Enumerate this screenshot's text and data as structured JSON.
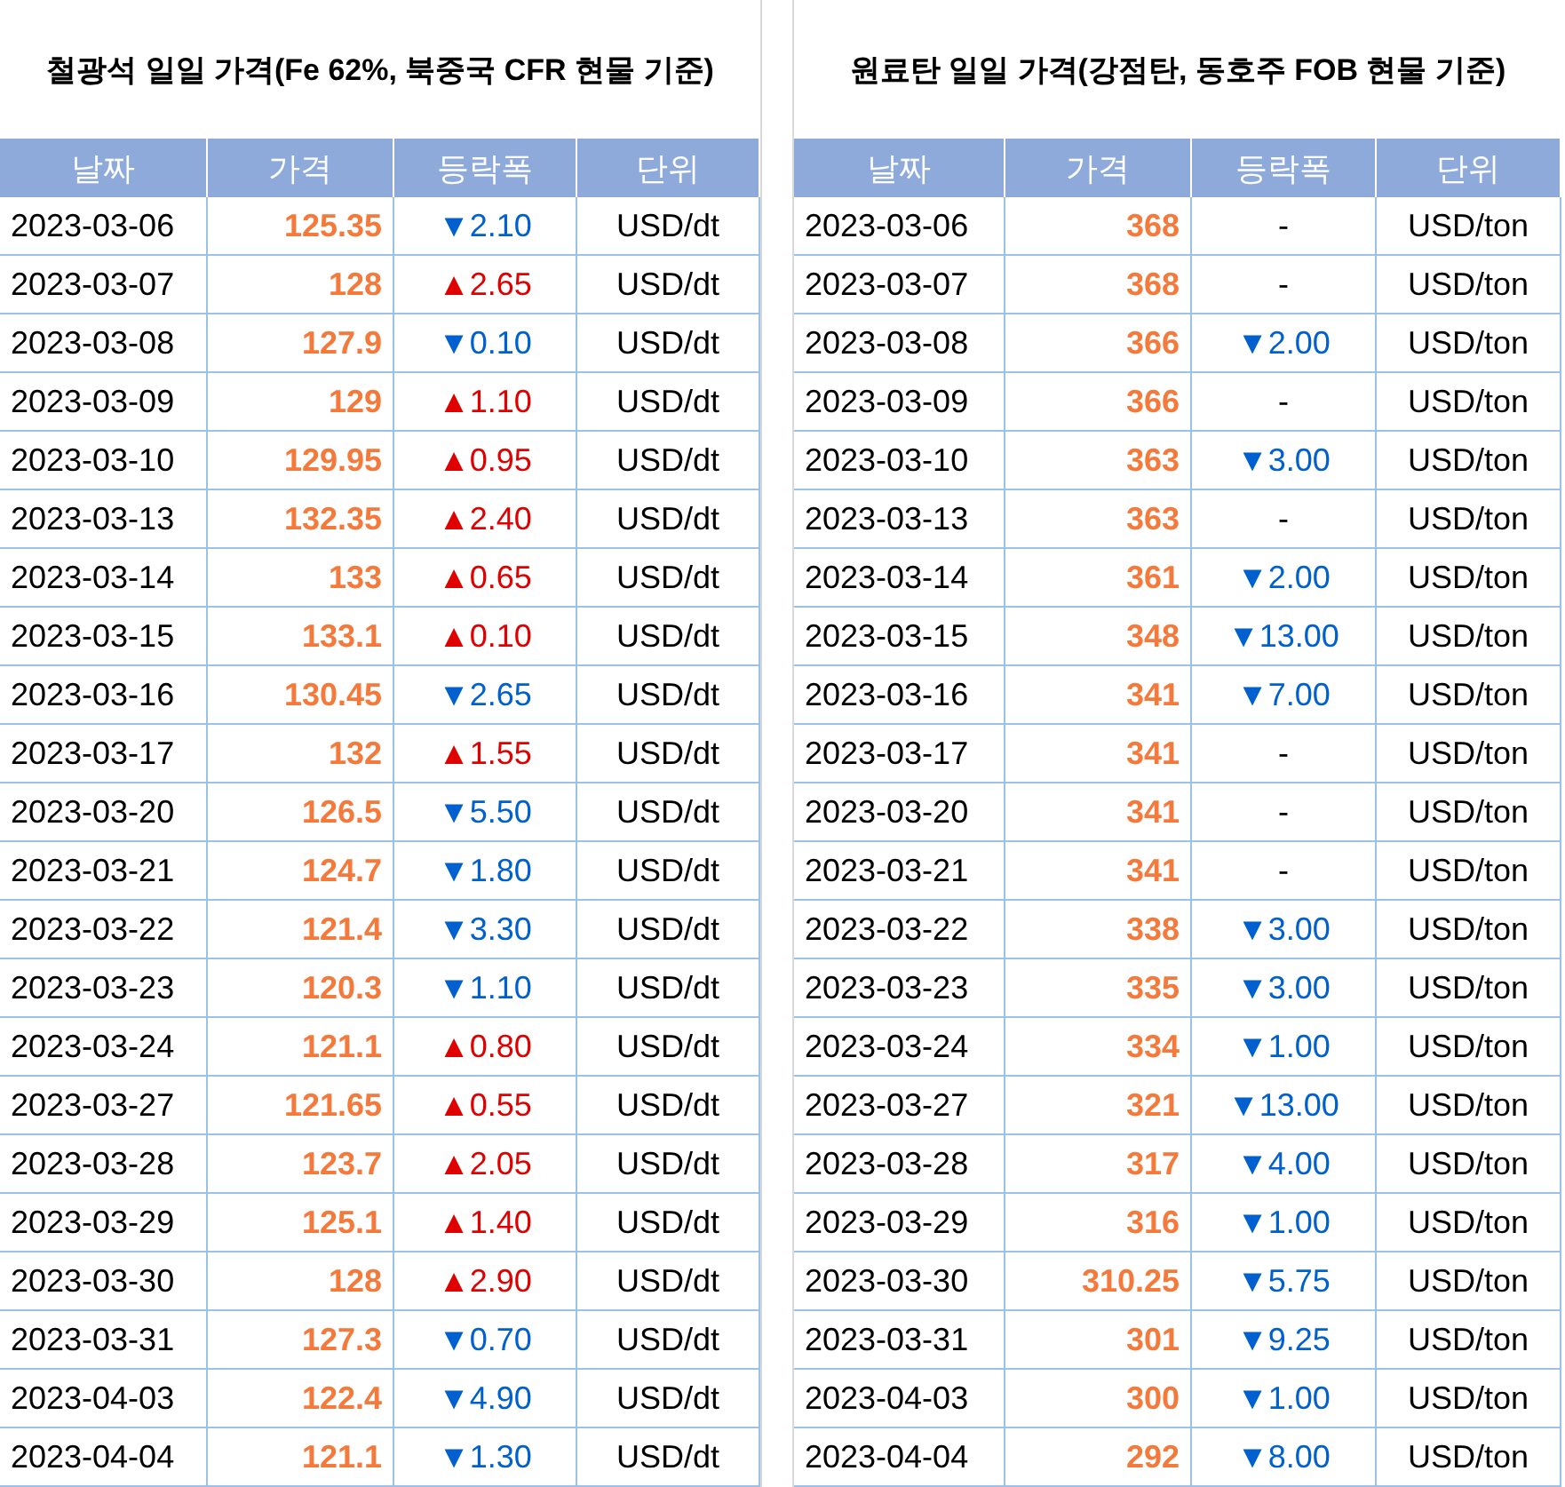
{
  "tables": [
    {
      "title": "철광석 일일 가격(Fe 62%, 북중국 CFR 현물 기준)",
      "columns": [
        "날짜",
        "가격",
        "등락폭",
        "단위"
      ],
      "rows": [
        {
          "date": "2023-03-06",
          "price": "125.35",
          "color": "#0060d0",
          "change": "▼2.10",
          "unit": "USD/dt"
        },
        {
          "date": "2023-03-07",
          "price": "128",
          "color": "#e00000",
          "change": "▲2.65",
          "unit": "USD/dt"
        },
        {
          "date": "2023-03-08",
          "price": "127.9",
          "color": "#0060d0",
          "change": "▼0.10",
          "unit": "USD/dt"
        },
        {
          "date": "2023-03-09",
          "price": "129",
          "color": "#e00000",
          "change": "▲1.10",
          "unit": "USD/dt"
        },
        {
          "date": "2023-03-10",
          "price": "129.95",
          "color": "#e00000",
          "change": "▲0.95",
          "unit": "USD/dt"
        },
        {
          "date": "2023-03-13",
          "price": "132.35",
          "color": "#e00000",
          "change": "▲2.40",
          "unit": "USD/dt"
        },
        {
          "date": "2023-03-14",
          "price": "133",
          "color": "#e00000",
          "change": "▲0.65",
          "unit": "USD/dt"
        },
        {
          "date": "2023-03-15",
          "price": "133.1",
          "color": "#e00000",
          "change": "▲0.10",
          "unit": "USD/dt"
        },
        {
          "date": "2023-03-16",
          "price": "130.45",
          "color": "#0060d0",
          "change": "▼2.65",
          "unit": "USD/dt"
        },
        {
          "date": "2023-03-17",
          "price": "132",
          "color": "#e00000",
          "change": "▲1.55",
          "unit": "USD/dt"
        },
        {
          "date": "2023-03-20",
          "price": "126.5",
          "color": "#0060d0",
          "change": "▼5.50",
          "unit": "USD/dt"
        },
        {
          "date": "2023-03-21",
          "price": "124.7",
          "color": "#0060d0",
          "change": "▼1.80",
          "unit": "USD/dt"
        },
        {
          "date": "2023-03-22",
          "price": "121.4",
          "color": "#0060d0",
          "change": "▼3.30",
          "unit": "USD/dt"
        },
        {
          "date": "2023-03-23",
          "price": "120.3",
          "color": "#0060d0",
          "change": "▼1.10",
          "unit": "USD/dt"
        },
        {
          "date": "2023-03-24",
          "price": "121.1",
          "color": "#e00000",
          "change": "▲0.80",
          "unit": "USD/dt"
        },
        {
          "date": "2023-03-27",
          "price": "121.65",
          "color": "#e00000",
          "change": "▲0.55",
          "unit": "USD/dt"
        },
        {
          "date": "2023-03-28",
          "price": "123.7",
          "color": "#e00000",
          "change": "▲2.05",
          "unit": "USD/dt"
        },
        {
          "date": "2023-03-29",
          "price": "125.1",
          "color": "#e00000",
          "change": "▲1.40",
          "unit": "USD/dt"
        },
        {
          "date": "2023-03-30",
          "price": "128",
          "color": "#e00000",
          "change": "▲2.90",
          "unit": "USD/dt"
        },
        {
          "date": "2023-03-31",
          "price": "127.3",
          "color": "#0060d0",
          "change": "▼0.70",
          "unit": "USD/dt"
        },
        {
          "date": "2023-04-03",
          "price": "122.4",
          "color": "#0060d0",
          "change": "▼4.90",
          "unit": "USD/dt"
        },
        {
          "date": "2023-04-04",
          "price": "121.1",
          "color": "#0060d0",
          "change": "▼1.30",
          "unit": "USD/dt"
        }
      ]
    },
    {
      "title": "원료탄 일일 가격(강점탄, 동호주 FOB 현물 기준)",
      "columns": [
        "날짜",
        "가격",
        "등락폭",
        "단위"
      ],
      "rows": [
        {
          "date": "2023-03-06",
          "price": "368",
          "color": "#000000",
          "change": "-",
          "unit": "USD/ton"
        },
        {
          "date": "2023-03-07",
          "price": "368",
          "color": "#000000",
          "change": "-",
          "unit": "USD/ton"
        },
        {
          "date": "2023-03-08",
          "price": "366",
          "color": "#0060d0",
          "change": "▼2.00",
          "unit": "USD/ton"
        },
        {
          "date": "2023-03-09",
          "price": "366",
          "color": "#000000",
          "change": "-",
          "unit": "USD/ton"
        },
        {
          "date": "2023-03-10",
          "price": "363",
          "color": "#0060d0",
          "change": "▼3.00",
          "unit": "USD/ton"
        },
        {
          "date": "2023-03-13",
          "price": "363",
          "color": "#000000",
          "change": "-",
          "unit": "USD/ton"
        },
        {
          "date": "2023-03-14",
          "price": "361",
          "color": "#0060d0",
          "change": "▼2.00",
          "unit": "USD/ton"
        },
        {
          "date": "2023-03-15",
          "price": "348",
          "color": "#0060d0",
          "change": "▼13.00",
          "unit": "USD/ton"
        },
        {
          "date": "2023-03-16",
          "price": "341",
          "color": "#0060d0",
          "change": "▼7.00",
          "unit": "USD/ton"
        },
        {
          "date": "2023-03-17",
          "price": "341",
          "color": "#000000",
          "change": "-",
          "unit": "USD/ton"
        },
        {
          "date": "2023-03-20",
          "price": "341",
          "color": "#000000",
          "change": "-",
          "unit": "USD/ton"
        },
        {
          "date": "2023-03-21",
          "price": "341",
          "color": "#000000",
          "change": "-",
          "unit": "USD/ton"
        },
        {
          "date": "2023-03-22",
          "price": "338",
          "color": "#0060d0",
          "change": "▼3.00",
          "unit": "USD/ton"
        },
        {
          "date": "2023-03-23",
          "price": "335",
          "color": "#0060d0",
          "change": "▼3.00",
          "unit": "USD/ton"
        },
        {
          "date": "2023-03-24",
          "price": "334",
          "color": "#0060d0",
          "change": "▼1.00",
          "unit": "USD/ton"
        },
        {
          "date": "2023-03-27",
          "price": "321",
          "color": "#0060d0",
          "change": "▼13.00",
          "unit": "USD/ton"
        },
        {
          "date": "2023-03-28",
          "price": "317",
          "color": "#0060d0",
          "change": "▼4.00",
          "unit": "USD/ton"
        },
        {
          "date": "2023-03-29",
          "price": "316",
          "color": "#0060d0",
          "change": "▼1.00",
          "unit": "USD/ton"
        },
        {
          "date": "2023-03-30",
          "price": "310.25",
          "color": "#0060d0",
          "change": "▼5.75",
          "unit": "USD/ton"
        },
        {
          "date": "2023-03-31",
          "price": "301",
          "color": "#0060d0",
          "change": "▼9.25",
          "unit": "USD/ton"
        },
        {
          "date": "2023-04-03",
          "price": "300",
          "color": "#0060d0",
          "change": "▼1.00",
          "unit": "USD/ton"
        },
        {
          "date": "2023-04-04",
          "price": "292",
          "color": "#0060d0",
          "change": "▼8.00",
          "unit": "USD/ton"
        }
      ]
    }
  ]
}
